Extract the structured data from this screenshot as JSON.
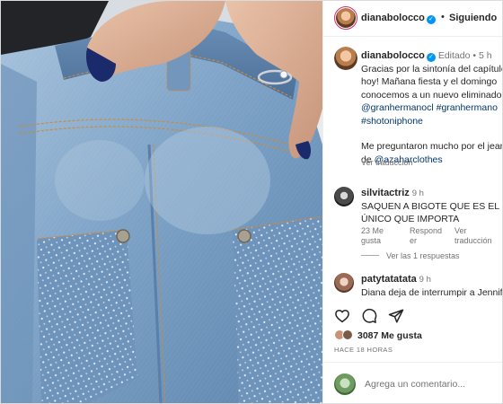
{
  "post": {
    "username": "dianabolocco",
    "follow_status": "Siguiendo",
    "header_separator": "•",
    "caption": {
      "username": "dianabolocco",
      "edited_label": "Editado",
      "separator": "•",
      "time": "5 h",
      "lines": [
        "Gracias por la sintonía del capítulo de",
        "hoy! Mañana fiesta y el domingo",
        "conocemos a un nuevo eliminado."
      ],
      "hashtag_lines": [
        "@granhermanocl #granhermano",
        "#shotoniphone"
      ],
      "extra_line": "Me preguntaron mucho por el jean, es",
      "extra_prefix": "de",
      "extra_mention": "@azaharclothes",
      "translate": "Ver traducción"
    },
    "comments": [
      {
        "username": "silvitactriz",
        "time": "9 h",
        "lines": [
          "SAQUEN A BIGOTE QUE ES EL",
          "ÚNICO QUE IMPORTA"
        ],
        "likes_label": "23 Me gusta",
        "likes_line1": "23 Me",
        "likes_line2": "gusta",
        "reply_line1": "Respond",
        "reply_line2": "er",
        "translate_line1": "Ver",
        "translate_line2": "traducción",
        "view_replies": "Ver las 1 respuestas"
      },
      {
        "username": "patytatatata",
        "time": "9 h",
        "lines": [
          "Diana deja de interrumpir a Jennifer"
        ]
      }
    ],
    "likes": "3087 Me gusta",
    "time_ago": "HACE 18 HORAS",
    "add_comment_placeholder": "Agrega un comentario..."
  },
  "icons": {
    "more": "more-options-icon",
    "heart": "heart-icon",
    "comment": "comment-icon",
    "share": "share-icon",
    "save": "bookmark-icon",
    "verified": "verified-badge-icon"
  },
  "colors": {
    "verified": "#0095f6",
    "link": "#00376b",
    "muted": "#737373",
    "text": "#262626",
    "story_ring": "#d62976"
  }
}
